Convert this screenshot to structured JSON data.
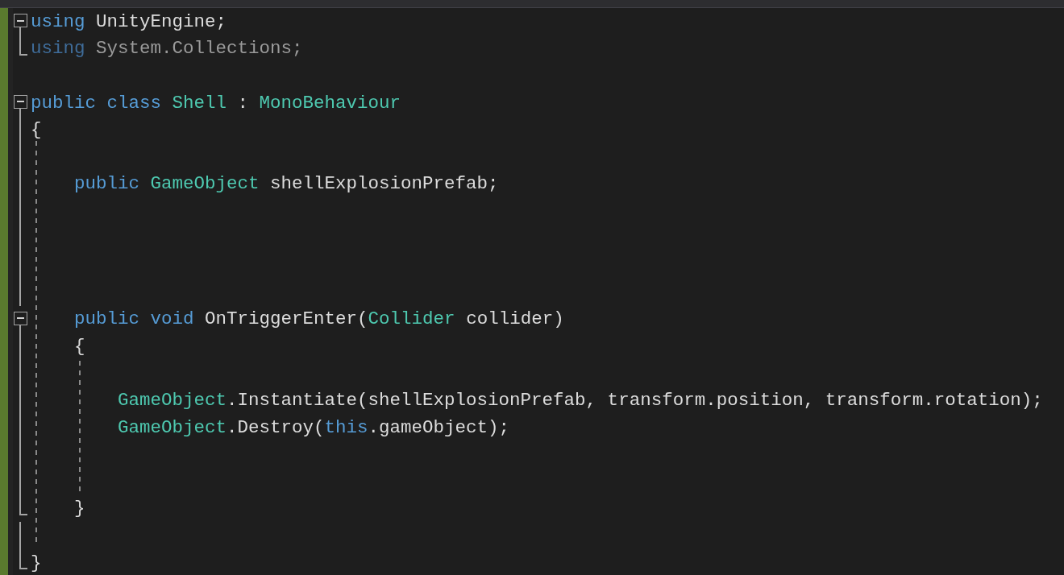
{
  "lines": [
    {
      "kind": "fold-start",
      "tokens": [
        {
          "kind": "keyword",
          "text": "using"
        },
        {
          "kind": "plain",
          "text": " UnityEngine;"
        }
      ]
    },
    {
      "kind": "fold-end",
      "tokens": [
        {
          "kind": "dim-keyword",
          "text": "using"
        },
        {
          "kind": "dim",
          "text": " System.Collections;"
        }
      ]
    },
    {
      "kind": "plain"
    },
    {
      "kind": "fold-start",
      "tokens": [
        {
          "kind": "keyword",
          "text": "public class"
        },
        {
          "kind": "type",
          "text": " Shell"
        },
        {
          "kind": "plain",
          "text": " : "
        },
        {
          "kind": "type",
          "text": "MonoBehaviour"
        }
      ]
    },
    {
      "kind": "fold-body",
      "tokens": [
        {
          "kind": "plain",
          "text": "{"
        }
      ]
    },
    {
      "kind": "fold-body"
    },
    {
      "kind": "fold-body",
      "tokens": [
        {
          "kind": "keyword",
          "text": "    public"
        },
        {
          "kind": "type",
          "text": " GameObject"
        },
        {
          "kind": "plain",
          "text": " shellExplosionPrefab;"
        }
      ]
    },
    {
      "kind": "fold-body"
    },
    {
      "kind": "fold-body"
    },
    {
      "kind": "fold-body"
    },
    {
      "kind": "fold-body"
    },
    {
      "kind": "fold-start",
      "tokens": [
        {
          "kind": "keyword",
          "text": "    public void"
        },
        {
          "kind": "plain",
          "text": " OnTriggerEnter("
        },
        {
          "kind": "type",
          "text": "Collider"
        },
        {
          "kind": "plain",
          "text": " collider)"
        }
      ]
    },
    {
      "kind": "fold-body",
      "tokens": [
        {
          "kind": "plain",
          "text": "    {"
        }
      ]
    },
    {
      "kind": "fold-body"
    },
    {
      "kind": "fold-body",
      "tokens": [
        {
          "kind": "type",
          "text": "        GameObject"
        },
        {
          "kind": "plain",
          "text": ".Instantiate(shellExplosionPrefab, transform.position, transform.rotation);"
        }
      ]
    },
    {
      "kind": "fold-body",
      "tokens": [
        {
          "kind": "type",
          "text": "        GameObject"
        },
        {
          "kind": "plain",
          "text": ".Destroy("
        },
        {
          "kind": "keyword",
          "text": "this"
        },
        {
          "kind": "plain",
          "text": ".gameObject);"
        }
      ]
    },
    {
      "kind": "fold-body"
    },
    {
      "kind": "fold-body"
    },
    {
      "kind": "fold-end",
      "tokens": [
        {
          "kind": "plain",
          "text": "    }"
        }
      ]
    },
    {
      "kind": "fold-body"
    },
    {
      "kind": "fold-end",
      "tokens": [
        {
          "kind": "plain",
          "text": "}"
        }
      ]
    }
  ]
}
